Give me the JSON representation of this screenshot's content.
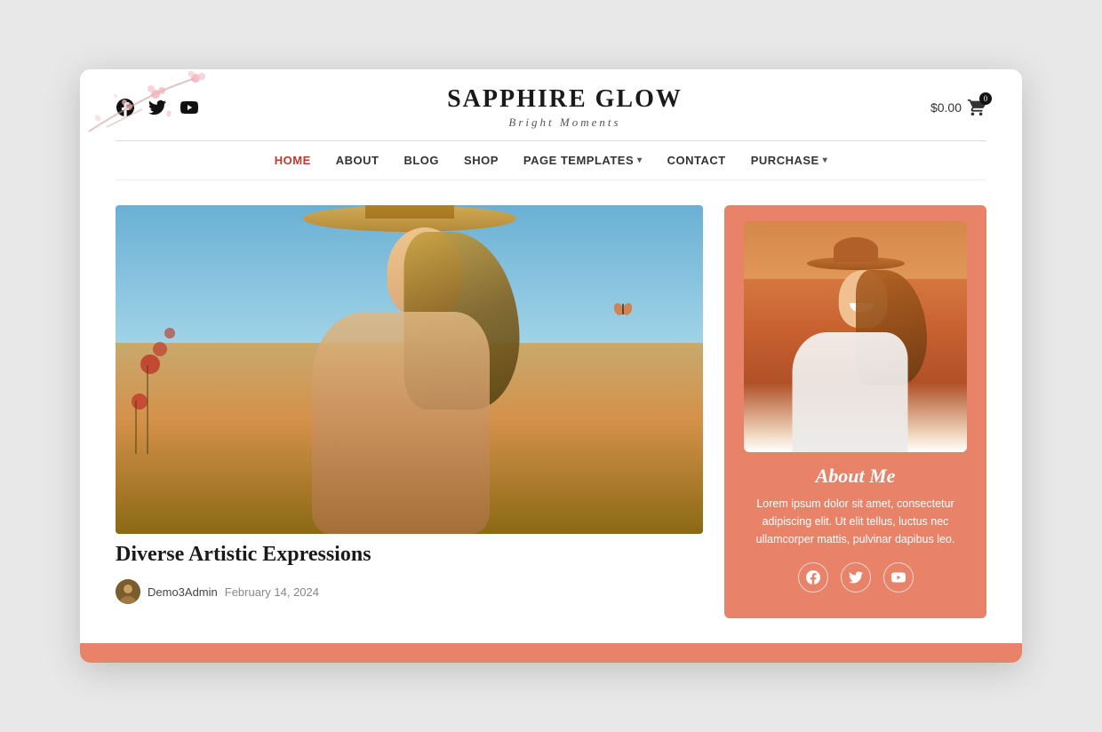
{
  "site": {
    "title": "SAPPHIRE GLOW",
    "tagline": "Bright Moments",
    "cart_price": "$0.00",
    "cart_count": "0"
  },
  "nav": {
    "items": [
      {
        "label": "HOME",
        "active": true
      },
      {
        "label": "ABOUT",
        "active": false
      },
      {
        "label": "BLOG",
        "active": false
      },
      {
        "label": "SHOP",
        "active": false
      },
      {
        "label": "PAGE TEMPLATES",
        "active": false,
        "has_dropdown": true
      },
      {
        "label": "CONTACT",
        "active": false
      },
      {
        "label": "PURCHASE",
        "active": false,
        "has_dropdown": true
      }
    ]
  },
  "main_post": {
    "title": "Diverse Artistic Expressions",
    "author": "Demo3Admin",
    "date": "February 14, 2024"
  },
  "sidebar": {
    "about_title": "About Me",
    "about_text": "Lorem ipsum dolor sit amet, consectetur adipiscing elit. Ut elit tellus, luctus nec ullamcorper mattis, pulvinar dapibus leo."
  },
  "social": {
    "facebook_label": "Facebook",
    "twitter_label": "Twitter",
    "youtube_label": "YouTube"
  },
  "colors": {
    "accent": "#e8836a",
    "nav_active": "#c0392b",
    "dark": "#1a1a1a"
  }
}
